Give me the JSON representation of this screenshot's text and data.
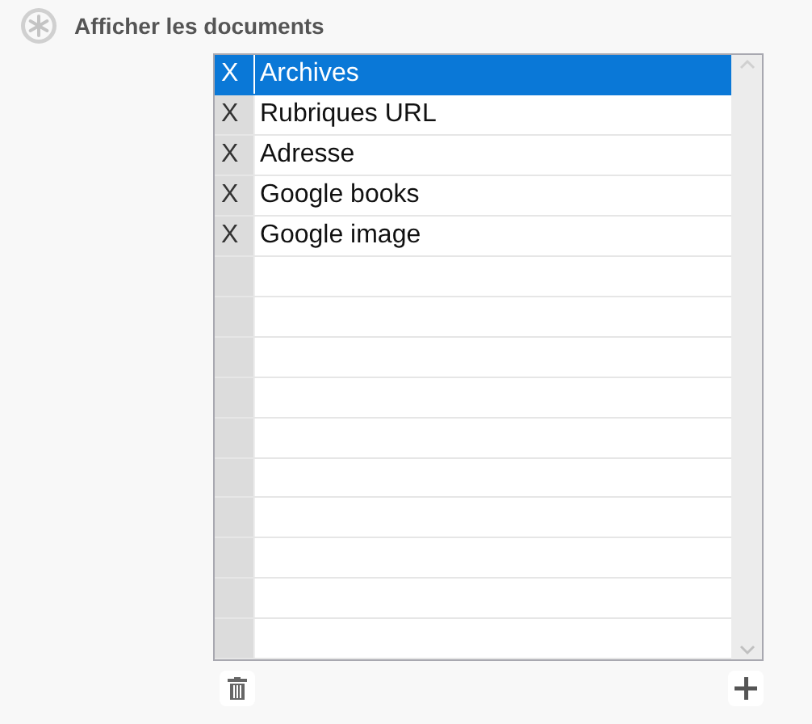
{
  "section": {
    "title": "Afficher les documents"
  },
  "list": {
    "rows": [
      {
        "marker": "X",
        "label": "Archives",
        "selected": true
      },
      {
        "marker": "X",
        "label": "Rubriques URL",
        "selected": false
      },
      {
        "marker": "X",
        "label": "Adresse",
        "selected": false
      },
      {
        "marker": "X",
        "label": "Google books",
        "selected": false
      },
      {
        "marker": "X",
        "label": "Google image",
        "selected": false
      }
    ]
  }
}
